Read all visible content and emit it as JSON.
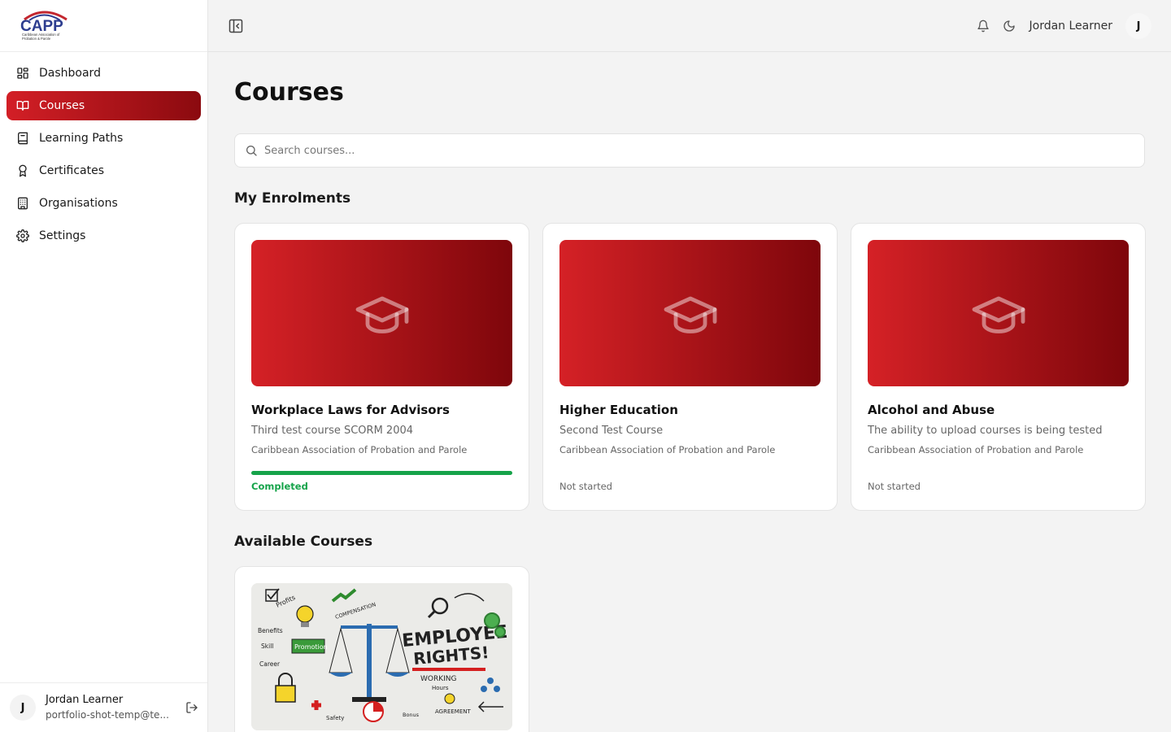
{
  "brand": {
    "logo_text": "CAPP",
    "logo_subtext_line1": "Caribbean Association of",
    "logo_subtext_line2": "Probation & Parole"
  },
  "sidebar": {
    "items": [
      {
        "label": "Dashboard",
        "icon": "dashboard-icon",
        "active": false
      },
      {
        "label": "Courses",
        "icon": "book-open-icon",
        "active": true
      },
      {
        "label": "Learning Paths",
        "icon": "book-icon",
        "active": false
      },
      {
        "label": "Certificates",
        "icon": "award-icon",
        "active": false
      },
      {
        "label": "Organisations",
        "icon": "building-icon",
        "active": false
      },
      {
        "label": "Settings",
        "icon": "gear-icon",
        "active": false
      }
    ],
    "user": {
      "initial": "J",
      "name": "Jordan Learner",
      "email": "portfolio-shot-temp@te..."
    }
  },
  "header": {
    "user_name": "Jordan Learner",
    "user_initial": "J"
  },
  "main": {
    "title": "Courses",
    "search_placeholder": "Search courses...",
    "enrolments_title": "My Enrolments",
    "available_title": "Available Courses",
    "enrolments": [
      {
        "title": "Workplace Laws for Advisors",
        "subtitle": "Third test course SCORM 2004",
        "org": "Caribbean Association of Probation and Parole",
        "status": "Completed",
        "progress_percent": 100
      },
      {
        "title": "Higher Education",
        "subtitle": "Second Test Course",
        "org": "Caribbean Association of Probation and Parole",
        "status": "Not started",
        "progress_percent": 0
      },
      {
        "title": "Alcohol and Abuse",
        "subtitle": "The ability to upload courses is being tested",
        "org": "Caribbean Association of Probation and Parole",
        "status": "Not started",
        "progress_percent": 0
      }
    ],
    "available_image": {
      "headline_line1": "EMPLOYEE",
      "headline_line2": "RIGHTS!",
      "words": [
        "Profits",
        "Benefits",
        "Skill",
        "Promotion",
        "Career",
        "COMPENSATION",
        "WORKING",
        "Hours",
        "AGREEMENT",
        "Safety",
        "Bonus"
      ]
    }
  },
  "colors": {
    "accent_start": "#d31f26",
    "accent_end": "#8b0a0f",
    "success": "#16a34a"
  }
}
